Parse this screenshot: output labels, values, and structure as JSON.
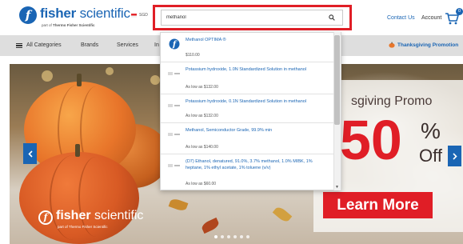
{
  "header": {
    "logo_word_bold": "fisher",
    "logo_word_rest": " scientific",
    "logo_sub_prefix": "part of ",
    "logo_sub_brand": "Thermo Fisher Scientific",
    "region": "SGD",
    "search_value": "methanol",
    "contact_label": "Contact Us",
    "account_label": "Account",
    "cart_count": "0"
  },
  "nav": {
    "all_categories": "All Categories",
    "brands": "Brands",
    "services": "Services",
    "partial_item": "In",
    "promotion": "Thanksgiving Promotion"
  },
  "search_suggestions": [
    {
      "name": "Methanol OPTIMA ®",
      "price": "$110.00",
      "thumb_icon": "fisher-logo-icon"
    },
    {
      "name": "Potassium hydroxide, 1.0N Standardized Solution in methanol",
      "price": "As low as $132.00",
      "thumb_icon": "product-thumbnail-icon"
    },
    {
      "name": "Potassium hydroxide, 0.1N Standardized Solution in methanol",
      "price": "As low as $132.00",
      "thumb_icon": "product-thumbnail-icon"
    },
    {
      "name": "Methanol, Semiconductor Grade, 99.9% min",
      "price": "As low as $140.00",
      "thumb_icon": "product-thumbnail-icon"
    },
    {
      "name": "(D7) Ethanol, denatured, 91.0%, 3.7% methanol, 1.0% MIBK, 1% heptane, 1% ethyl acetate, 1% toluene (v/v)",
      "price": "As low as $60.00",
      "thumb_icon": "product-thumbnail-icon"
    }
  ],
  "hero": {
    "title_partial": "sgiving Promo",
    "big_number": "50",
    "percent": "%",
    "off": "Off",
    "cta_label": "Learn More",
    "logo_word_bold": "fisher",
    "logo_word_rest": " scientific",
    "logo_sub": "part of Thermo Fisher Scientific",
    "slide_count": 6,
    "active_slide": 1
  },
  "colors": {
    "brand_blue": "#1a65b4",
    "promo_red": "#e01e26",
    "highlight_frame": "#e01e26",
    "nav_bg": "#dedede"
  }
}
